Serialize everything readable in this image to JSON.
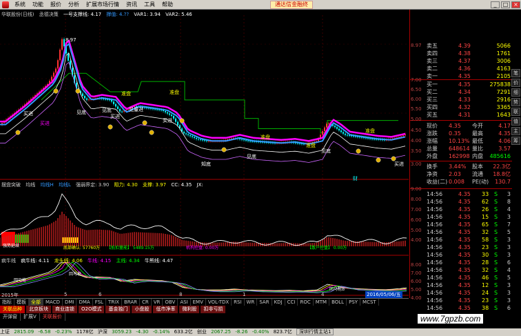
{
  "menu": {
    "items": [
      "系统",
      "功能",
      "报价",
      "分析",
      "扩展市场行情",
      "资讯",
      "工具",
      "帮助"
    ],
    "promo": "通达信金融终",
    "window_buttons": [
      "_",
      "□",
      "×"
    ]
  },
  "main_header": {
    "stock": "华联股份(日线)",
    "indicator": "丞德决策",
    "support_label": "一号支撑线: 4.17",
    "mid_label": "撑值: 4.??",
    "var1": "VAR1: 3.94",
    "var2": "VAR2: 5.46"
  },
  "main_chart": {
    "peak_label": "8.97",
    "annotations": [
      "买进",
      "买进",
      "见底",
      "见底",
      "见量进",
      "买进",
      "见底",
      "知底",
      "见底",
      "买进",
      "见底",
      "见底",
      "见底",
      "见底",
      "买进",
      "见底"
    ],
    "plate_labels": [
      "准盘",
      "准盘",
      "准盘",
      "准盘",
      "准盘"
    ],
    "bottom_tag": "财"
  },
  "ind1_header": {
    "name": "摆盘突破",
    "a": "均线",
    "b": "均线H",
    "c": "均线L",
    "d": "强弱界定: 3.90",
    "e": "阻力: 4.30",
    "f": "支撑: 3.97",
    "g": "CC: 4.35",
    "h": "JX:"
  },
  "ind1_labels": [
    "强势延续",
    "底部确认: 57760万",
    "【抵扣量能】 5489.15万",
    "机构控盘: 0.00万",
    "【散户控盘】 0.00万"
  ],
  "ind2_header": {
    "name": "疯牛线",
    "a": "疯牛线: 4.11",
    "b": "龙头线: 4.06",
    "c": "牛线: 4.15",
    "d": "主线: 4.34",
    "e": "牛熊线: 4.47"
  },
  "ind2_labels": [
    "回马枪",
    "回马枪",
    "回马枪",
    "回马枪",
    "回马枪B"
  ],
  "dates": [
    "2015年",
    "5",
    "6",
    "8",
    "1",
    "4",
    "2016/05/06/五"
  ],
  "price_axis": [
    "8.97",
    "7.00",
    "6.50",
    "6.00",
    "5.50",
    "5.00",
    "4.50",
    "4.00",
    "3.50",
    "3.00"
  ],
  "ind1_axis": [
    "9.00",
    "8.00",
    "7.00",
    "6.00",
    "5.00",
    "4.00"
  ],
  "ind2_axis": [
    "8.00",
    "7.00",
    "6.00",
    "5.00",
    "4.00"
  ],
  "quote": {
    "sell": [
      {
        "label": "卖五",
        "price": "4.39",
        "vol": "5066"
      },
      {
        "label": "卖四",
        "price": "4.38",
        "vol": "1761"
      },
      {
        "label": "卖三",
        "price": "4.37",
        "vol": "3006"
      },
      {
        "label": "卖二",
        "price": "4.36",
        "vol": "4163"
      },
      {
        "label": "卖一",
        "price": "4.35",
        "vol": "2105"
      }
    ],
    "buy": [
      {
        "label": "买一",
        "price": "4.35",
        "vol": "275838"
      },
      {
        "label": "买二",
        "price": "4.34",
        "vol": "7291"
      },
      {
        "label": "买三",
        "price": "4.33",
        "vol": "2916"
      },
      {
        "label": "买四",
        "price": "4.32",
        "vol": "3365"
      },
      {
        "label": "买五",
        "price": "4.31",
        "vol": "1643"
      }
    ],
    "stats": [
      {
        "l1": "现价",
        "v1": "4.35",
        "l2": "今开",
        "v2": "4.17"
      },
      {
        "l1": "涨跌",
        "v1": "0.35",
        "l2": "最高",
        "v2": "4.35"
      },
      {
        "l1": "涨幅",
        "v1": "10.13%",
        "l2": "最低",
        "v2": "4.06"
      },
      {
        "l1": "总量",
        "v1": "648614",
        "l2": "量比",
        "v2": "3.57"
      },
      {
        "l1": "外盘",
        "v1": "162998",
        "l2": "内盘",
        "v2": "485616"
      },
      {
        "l1": "换手",
        "v1": "3.44%",
        "l2": "股本",
        "v2": "22.3亿"
      },
      {
        "l1": "净资",
        "v1": "2.03",
        "l2": "流通",
        "v2": "18.8亿"
      },
      {
        "l1": "收益(二)",
        "v1": "0.008",
        "l2": "PE(动)",
        "v2": "130.7"
      }
    ],
    "trades": [
      {
        "t": "14:56",
        "p": "4.35",
        "v": "33",
        "f": "S",
        "n": "3"
      },
      {
        "t": "14:56",
        "p": "4.35",
        "v": "62",
        "f": "S",
        "n": "8"
      },
      {
        "t": "14:56",
        "p": "4.35",
        "v": "26",
        "f": "S",
        "n": "4"
      },
      {
        "t": "14:56",
        "p": "4.35",
        "v": "15",
        "f": "S",
        "n": "3"
      },
      {
        "t": "14:56",
        "p": "4.35",
        "v": "65",
        "f": "S",
        "n": "7"
      },
      {
        "t": "14:56",
        "p": "4.35",
        "v": "32",
        "f": "S",
        "n": "5"
      },
      {
        "t": "14:56",
        "p": "4.35",
        "v": "58",
        "f": "S",
        "n": "3"
      },
      {
        "t": "14:56",
        "p": "4.35",
        "v": "23",
        "f": "S",
        "n": "3"
      },
      {
        "t": "14:56",
        "p": "4.35",
        "v": "30",
        "f": "S",
        "n": "3"
      },
      {
        "t": "14:56",
        "p": "4.35",
        "v": "28",
        "f": "S",
        "n": "6"
      },
      {
        "t": "14:56",
        "p": "4.35",
        "v": "32",
        "f": "S",
        "n": "4"
      },
      {
        "t": "14:56",
        "p": "4.35",
        "v": "46",
        "f": "S",
        "n": "5"
      },
      {
        "t": "14:56",
        "p": "4.35",
        "v": "12",
        "f": "S",
        "n": "3"
      },
      {
        "t": "14:56",
        "p": "4.35",
        "v": "24",
        "f": "S",
        "n": "3"
      },
      {
        "t": "14:56",
        "p": "4.35",
        "v": "23",
        "f": "S",
        "n": "3"
      },
      {
        "t": "14:56",
        "p": "4.35",
        "v": "38",
        "f": "S",
        "n": "6"
      }
    ],
    "side_tabs": [
      "笔",
      "价",
      "细",
      "势",
      "联",
      "值",
      "主",
      "筹"
    ]
  },
  "bottom": {
    "tabs1": [
      "指标",
      "模板",
      "全部",
      "MACD",
      "DMI",
      "DMA",
      "FSL",
      "TRIX",
      "BRAR",
      "CR",
      "VR",
      "OBV",
      "ASI",
      "EMV",
      "VOL-TDX",
      "RSI",
      "WR",
      "SAR",
      "KDJ",
      "CCI",
      "ROC",
      "MTM",
      "BOLL",
      "PSY",
      "MCST"
    ],
    "tabs2": [
      "关联品种",
      "北京板块",
      "商业连锁",
      "O2O模式",
      "基金独门",
      "小盘股",
      "低市净率",
      "微利股",
      "扣非亏损"
    ],
    "tabs3": [
      "开弹窗",
      "扩展V",
      "关联报价"
    ],
    "status": {
      "sh_label": "上证",
      "sh": "2815.09",
      "sh_chg": "-6.58",
      "sh_pct": "-0.23%",
      "sh_amt": "1178亿",
      "sz_label": "沪深",
      "sz": "3059.23",
      "sz_chg": "-4.30",
      "sz_pct": "-0.14%",
      "sz_amt": "633.2亿",
      "cy_label": "创业",
      "cy": "2067.25",
      "cy_chg": "-8.26",
      "cy_pct": "-0.40%",
      "cy_amt": "823.7亿",
      "feed": "深圳行情主站1"
    },
    "watermark": "www.7gpzb.com"
  },
  "colors": {
    "up": "#ff3333",
    "down": "#00ffff",
    "support": "#00b000",
    "accent_yellow": "#ffff00",
    "magenta": "#ff00ff"
  }
}
